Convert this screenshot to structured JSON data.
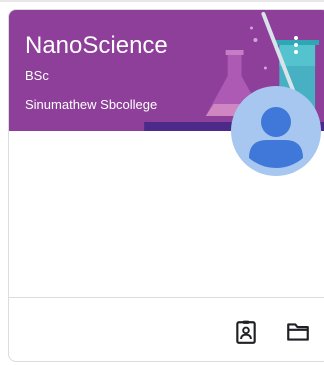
{
  "course": {
    "title": "NanoScience",
    "section": "BSc",
    "teacher": "Sinumathew Sbcollege"
  },
  "icons": {
    "more": "more-vert-icon",
    "avatar": "person-avatar-icon",
    "portfolio": "assignment-ind-icon",
    "folder": "folder-icon"
  },
  "colors": {
    "banner": "#8e3f9a",
    "avatar_bg": "#a8c7f0",
    "avatar_fg": "#3f78d8"
  }
}
